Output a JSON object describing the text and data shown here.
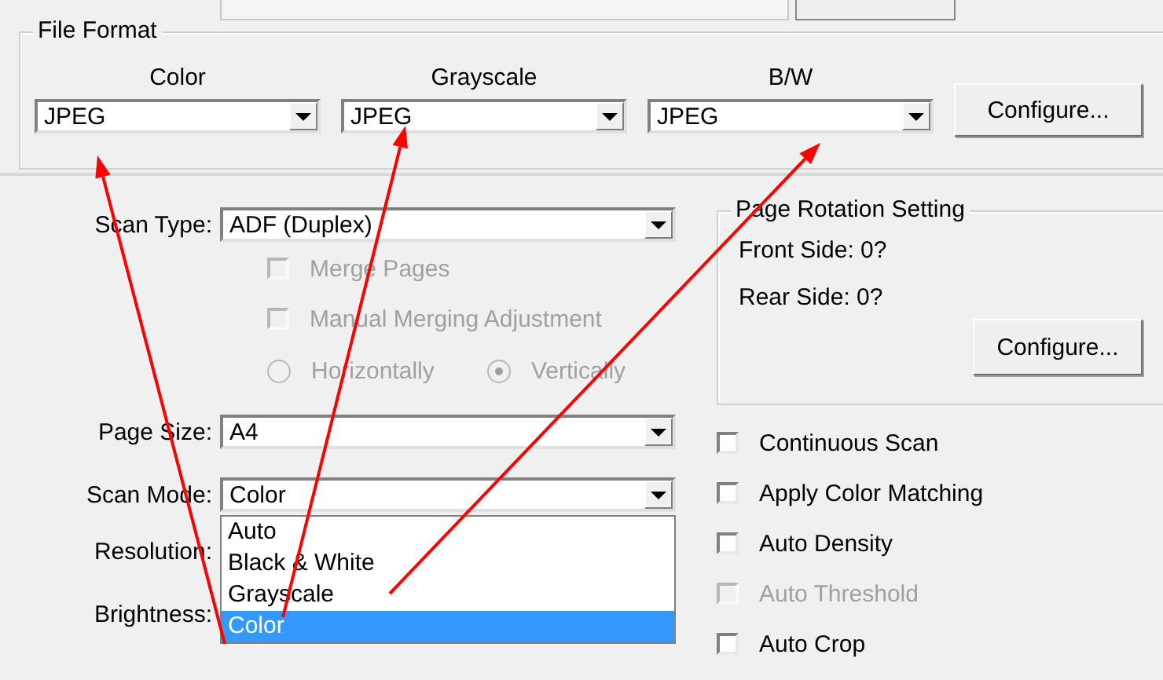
{
  "file_format": {
    "title": "File Format",
    "columns": [
      {
        "label": "Color",
        "value": "JPEG"
      },
      {
        "label": "Grayscale",
        "value": "JPEG"
      },
      {
        "label": "B/W",
        "value": "JPEG"
      }
    ],
    "configure_button": "Configure..."
  },
  "scan_type": {
    "label": "Scan Type:",
    "value": "ADF (Duplex)"
  },
  "merge_options": [
    {
      "label": "Merge Pages",
      "checked": false,
      "disabled": true
    },
    {
      "label": "Manual Merging Adjustment",
      "checked": false,
      "disabled": true
    }
  ],
  "merge_direction": [
    {
      "label": "Horizontally",
      "selected": false,
      "disabled": true
    },
    {
      "label": "Vertically",
      "selected": true,
      "disabled": true
    }
  ],
  "page_size": {
    "label": "Page Size:",
    "value": "A4"
  },
  "scan_mode": {
    "label": "Scan Mode:",
    "value": "Color",
    "options": [
      {
        "label": "Auto",
        "selected": false
      },
      {
        "label": "Black & White",
        "selected": false
      },
      {
        "label": "Grayscale",
        "selected": false
      },
      {
        "label": "Color",
        "selected": true
      }
    ]
  },
  "resolution": {
    "label": "Resolution:"
  },
  "brightness": {
    "label": "Brightness:"
  },
  "page_rotation": {
    "title": "Page Rotation Setting",
    "front_side": "Front Side: 0?",
    "rear_side": "Rear Side: 0?",
    "configure_button": "Configure..."
  },
  "options": [
    {
      "label": "Continuous Scan",
      "checked": false,
      "disabled": false
    },
    {
      "label": "Apply Color Matching",
      "checked": false,
      "disabled": false
    },
    {
      "label": "Auto Density",
      "checked": false,
      "disabled": false
    },
    {
      "label": "Auto Threshold",
      "checked": false,
      "disabled": true
    },
    {
      "label": "Auto Crop",
      "checked": false,
      "disabled": false
    }
  ]
}
